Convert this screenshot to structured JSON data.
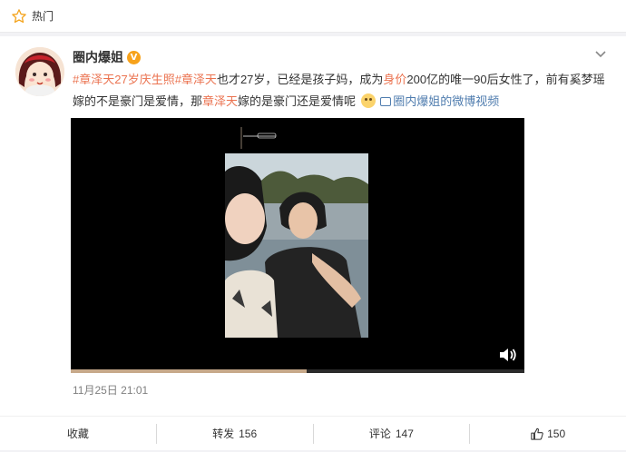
{
  "hot": {
    "label": "热门",
    "icon": "star-outline-icon"
  },
  "post": {
    "author": "圈内爆姐",
    "verified_badge": "V",
    "text_segments": [
      {
        "type": "tag",
        "text": "#章泽天27岁庆生照#"
      },
      {
        "type": "link",
        "text": "章泽天"
      },
      {
        "type": "text",
        "text": "也才27岁，已经是孩子妈，成为"
      },
      {
        "type": "link",
        "text": "身价"
      },
      {
        "type": "text",
        "text": "200亿的唯一90后女性了，前有奚梦瑶嫁的不是豪门是爱情，那"
      },
      {
        "type": "link",
        "text": "章泽天"
      },
      {
        "type": "text",
        "text": "嫁的是豪门还是爱情呢"
      }
    ],
    "video_link_text": "圈内爆姐的微博视频",
    "timestamp": "11月25日 21:01"
  },
  "video": {
    "progress": 0.52,
    "volume_icon": "volume-icon"
  },
  "actions": [
    {
      "name": "favorite",
      "label": "收藏",
      "count": ""
    },
    {
      "name": "repost",
      "label": "转发",
      "count": "156"
    },
    {
      "name": "comment",
      "label": "评论",
      "count": "147"
    },
    {
      "name": "like",
      "label": "",
      "count": "150",
      "icon": "thumbs-up-icon"
    }
  ],
  "colors": {
    "accent": "#eb7350",
    "link_blue": "#507daf",
    "badge": "#f7a21b"
  }
}
